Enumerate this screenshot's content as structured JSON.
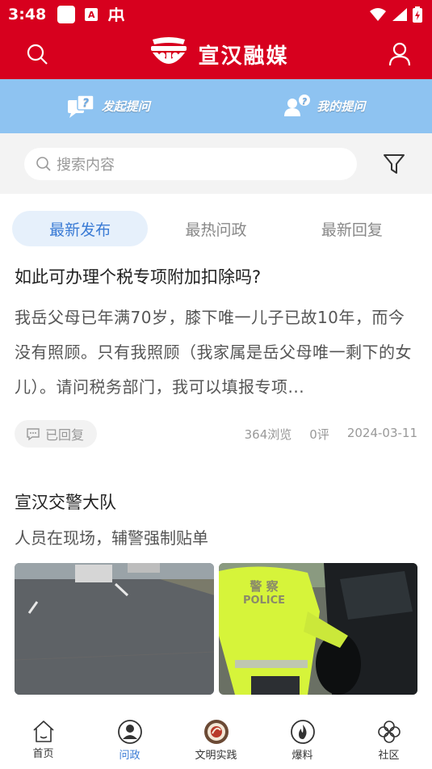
{
  "status_bar": {
    "time": "3:48",
    "icons": [
      "square-icon",
      "a-icon",
      "app-icon",
      "wifi-icon",
      "signal-icon",
      "battery-icon"
    ]
  },
  "header": {
    "title": "宣汉融媒",
    "brand_color": "#d7001e"
  },
  "ask_bar": {
    "ask_label": "发起提问",
    "my_questions_label": "我的提问",
    "bg_color": "#8ec3f1"
  },
  "search": {
    "placeholder": "搜索内容"
  },
  "tabs": [
    {
      "label": "最新发布",
      "active": true
    },
    {
      "label": "最热问政",
      "active": false
    },
    {
      "label": "最新回复",
      "active": false
    }
  ],
  "posts": [
    {
      "title": "如此可办理个税专项附加扣除吗?",
      "body": "我岳父母已年满70岁，膝下唯一儿子已故10年，而今没有照顾。只有我照顾（我家属是岳父母唯一剩下的女儿）。请问税务部门，我可以填报专项...",
      "status": "已回复",
      "views": "364浏览",
      "comments": "0评",
      "date": "2024-03-11"
    },
    {
      "title": "宣汉交警大队",
      "subtitle": "人员在现场，辅警强制贴单",
      "photo_text_1": "警 察",
      "photo_text_2": "POLICE"
    }
  ],
  "bottom_nav": [
    {
      "label": "首页",
      "icon": "home-icon",
      "active": false
    },
    {
      "label": "问政",
      "icon": "user-circle-icon",
      "active": true
    },
    {
      "label": "文明实践",
      "icon": "emblem-icon",
      "active": false
    },
    {
      "label": "爆料",
      "icon": "flame-icon",
      "active": false
    },
    {
      "label": "社区",
      "icon": "clover-icon",
      "active": false
    }
  ],
  "accent_color": "#3a7bd5"
}
